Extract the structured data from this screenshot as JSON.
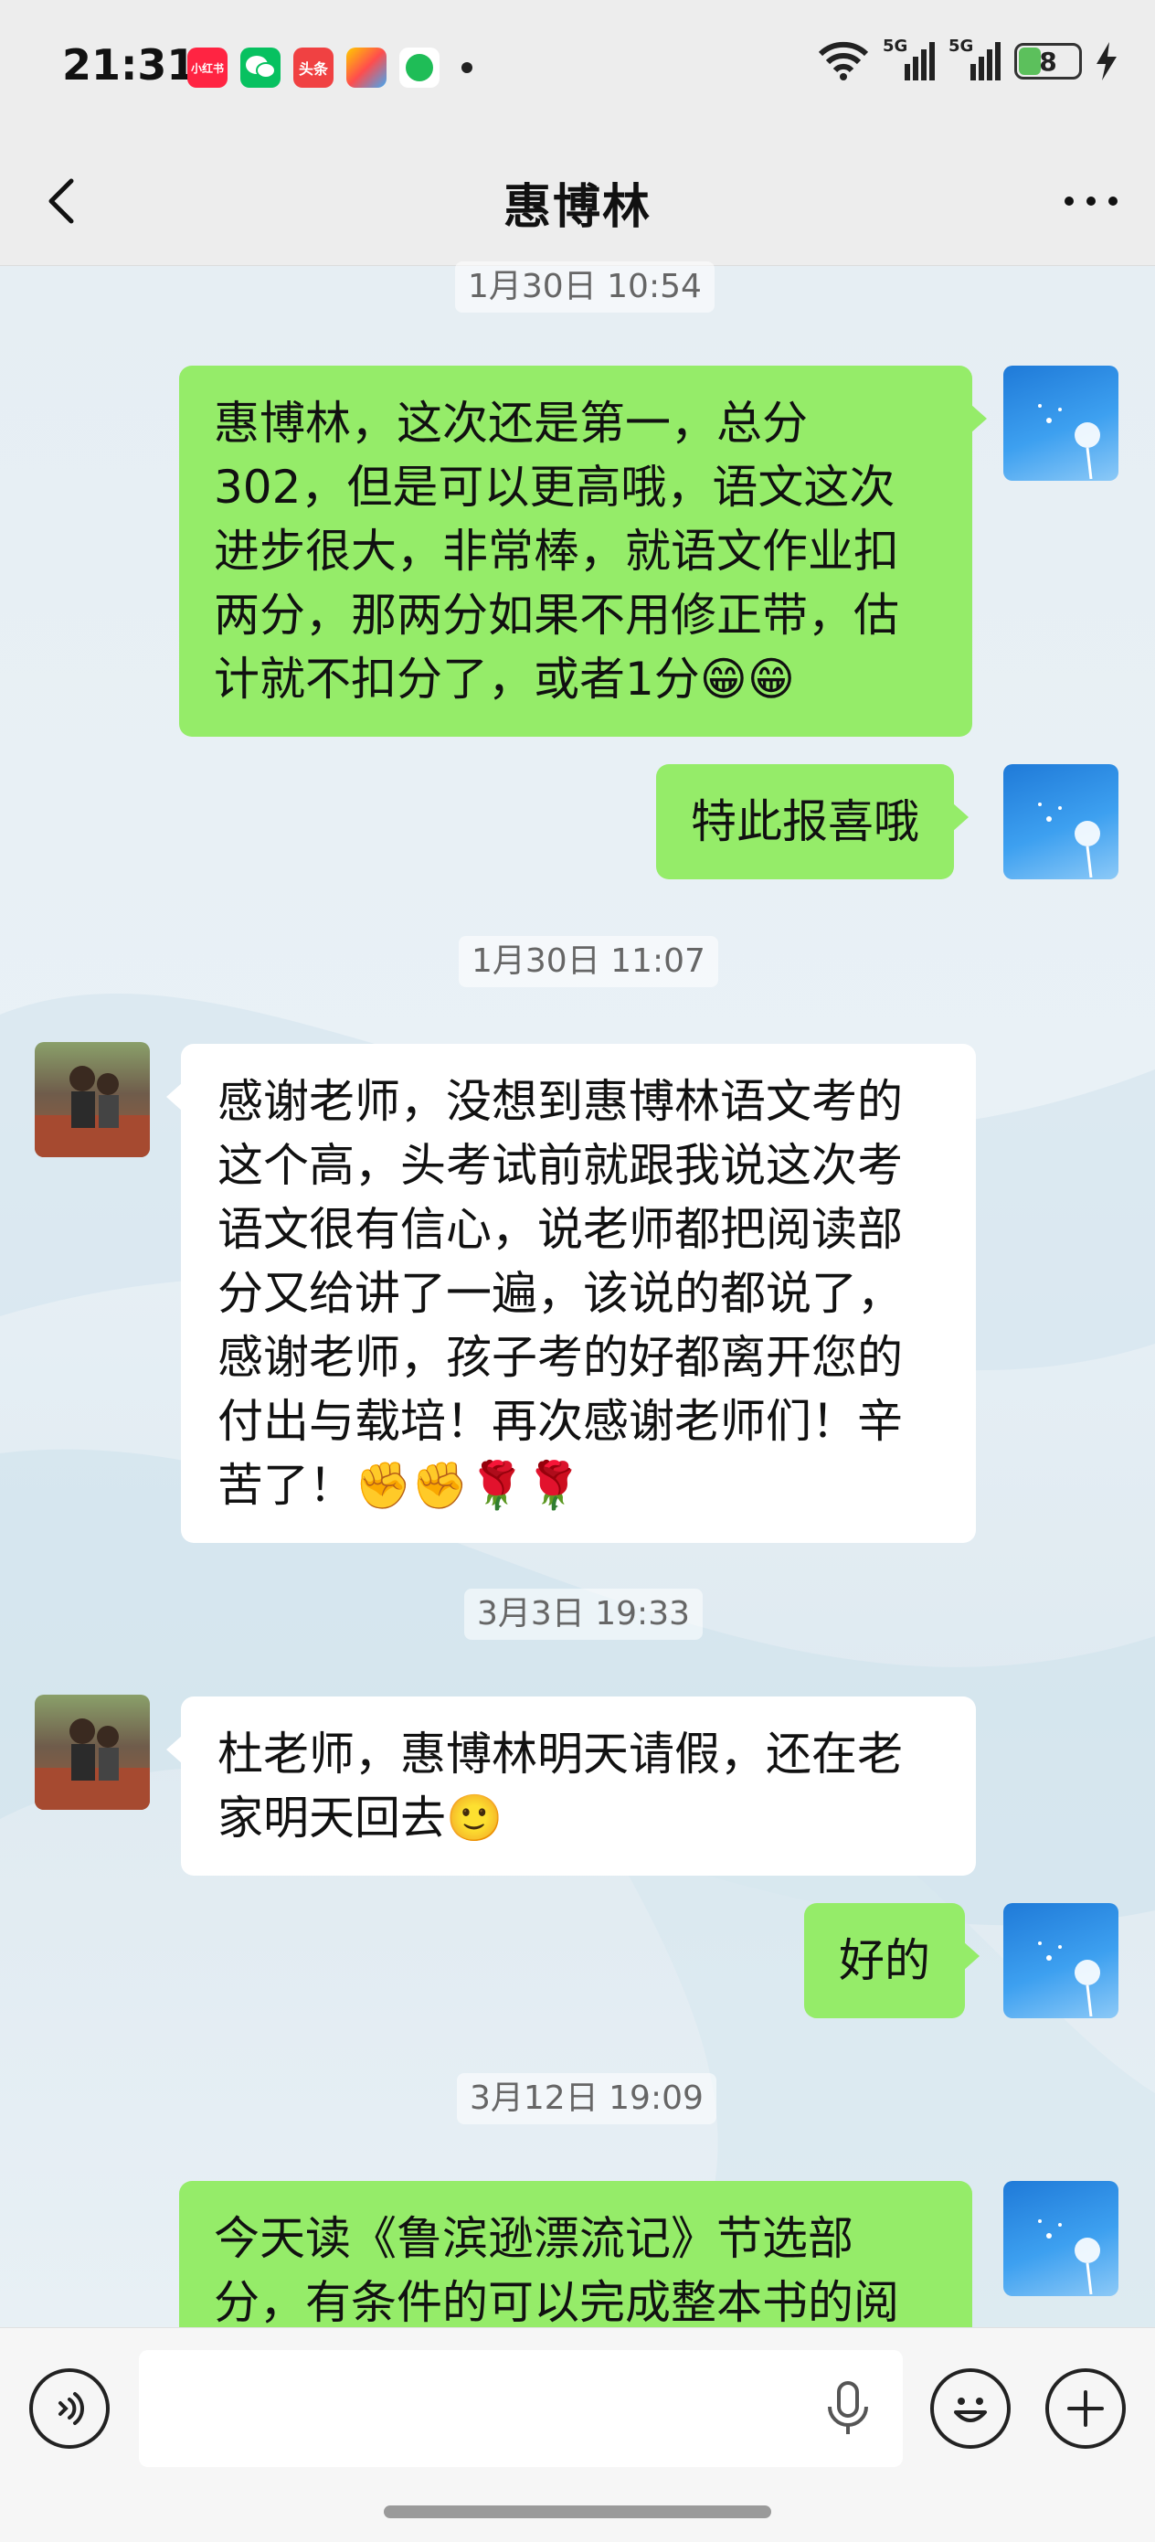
{
  "status_bar": {
    "time": "21:31",
    "notification_icons": [
      "xiaohongshu-icon",
      "wechat-icon",
      "toutiao-icon",
      "game-app-icon",
      "chat-app-icon"
    ],
    "notif_labels": {
      "xiaohongshu": "小红书",
      "toutiao": "头条"
    },
    "network": [
      "5G",
      "5G"
    ],
    "battery": "8"
  },
  "header": {
    "title": "惠博林"
  },
  "messages": [
    {
      "timestamp": "1月30日 10:54"
    },
    {
      "sender": "me",
      "text": "惠博林，这次还是第一，总分302，但是可以更高哦，语文这次进步很大，非常棒，就语文作业扣两分，那两分如果不用修正带，估计就不扣分了，或者1分😁😁"
    },
    {
      "sender": "me",
      "text": "特此报喜哦"
    },
    {
      "timestamp": "1月30日 11:07"
    },
    {
      "sender": "them",
      "text": "感谢老师，没想到惠博林语文考的这个高，头考试前就跟我说这次考语文很有信心，说老师都把阅读部分又给讲了一遍，该说的都说了，感谢老师，孩子考的好都离开您的付出与载培！再次感谢老师们！辛苦了！✊✊🌹🌹"
    },
    {
      "timestamp": "3月3日 19:33"
    },
    {
      "sender": "them",
      "text": "杜老师，惠博林明天请假，还在老家明天回去🙂"
    },
    {
      "sender": "me",
      "text": "好的"
    },
    {
      "timestamp": "3月12日 19:09"
    },
    {
      "sender": "me",
      "text": "今天读《鲁滨逊漂流记》节选部分，有条件的可以完成整本书的阅"
    }
  ],
  "input_bar": {
    "placeholder": ""
  },
  "colors": {
    "bubble_me": "#95ec69",
    "bubble_them": "#ffffff",
    "header_bg": "#ededed"
  }
}
